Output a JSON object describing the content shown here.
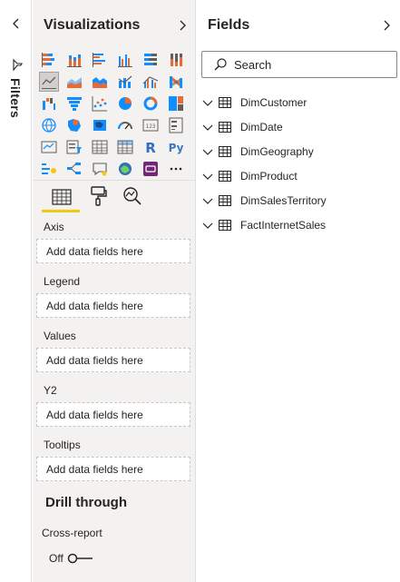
{
  "filters": {
    "label": "Filters"
  },
  "visualizations": {
    "title": "Visualizations",
    "icons": [
      "stacked-bar-chart-icon",
      "stacked-column-chart-icon",
      "clustered-bar-chart-icon",
      "clustered-column-chart-icon",
      "100-percent-stacked-bar-chart-icon",
      "100-percent-stacked-column-chart-icon",
      "line-chart-icon",
      "area-chart-icon",
      "stacked-area-chart-icon",
      "line-and-stacked-column-chart-icon",
      "line-and-clustered-column-chart-icon",
      "ribbon-chart-icon",
      "waterfall-chart-icon",
      "funnel-chart-icon",
      "scatter-chart-icon",
      "pie-chart-icon",
      "donut-chart-icon",
      "treemap-icon",
      "map-icon",
      "filled-map-icon",
      "shape-map-icon",
      "gauge-icon",
      "card-icon",
      "multi-row-card-icon",
      "kpi-icon",
      "slicer-icon",
      "table-icon",
      "matrix-icon",
      "r-script-visual-icon",
      "python-visual-icon",
      "key-influencers-icon",
      "decomposition-tree-icon",
      "qa-visual-icon",
      "arcgis-map-icon",
      "power-apps-icon",
      "more-visuals-icon"
    ],
    "tabs": [
      "fields-tab-icon",
      "format-tab-icon",
      "analytics-tab-icon"
    ],
    "wells": [
      {
        "label": "Axis",
        "placeholder": "Add data fields here"
      },
      {
        "label": "Legend",
        "placeholder": "Add data fields here"
      },
      {
        "label": "Values",
        "placeholder": "Add data fields here"
      },
      {
        "label": "Y2",
        "placeholder": "Add data fields here"
      },
      {
        "label": "Tooltips",
        "placeholder": "Add data fields here"
      }
    ],
    "drill_through": {
      "title": "Drill through",
      "cross_report_label": "Cross-report",
      "toggle_state": "Off"
    }
  },
  "fields": {
    "title": "Fields",
    "search_placeholder": "Search",
    "tables": [
      "DimCustomer",
      "DimDate",
      "DimGeography",
      "DimProduct",
      "DimSalesTerritory",
      "FactInternetSales"
    ]
  },
  "colors": {
    "accent": "#f2c811",
    "pane_bg": "#f3f2f1",
    "border": "#e1dfdd",
    "text": "#252423"
  }
}
